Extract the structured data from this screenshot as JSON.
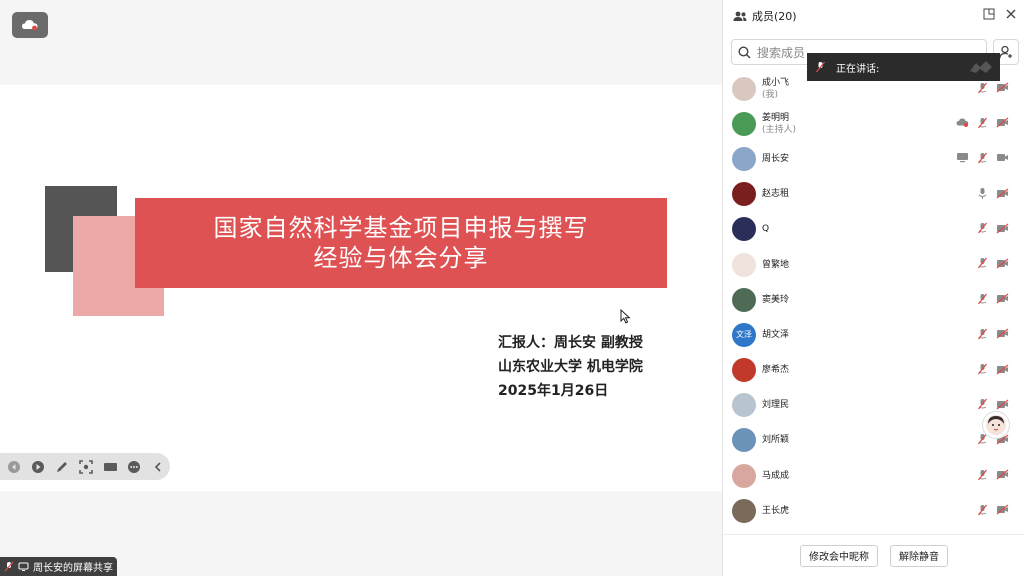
{
  "share": {
    "title_line1": "国家自然科学基金项目申报与撰写",
    "title_line2": "经验与体会分享",
    "reporter": "汇报人：周长安  副教授",
    "affiliation": "山东农业大学 机电学院",
    "date": "2025年1月26日",
    "sharing_label": "周长安的屏幕共享",
    "accent_color": "#de5254"
  },
  "panel": {
    "title": "成员(20)",
    "search_placeholder": "搜索成员",
    "speaking_label": "正在讲话:",
    "members": [
      {
        "name": "成小飞",
        "sub": "(我)",
        "avatar_color": "#d9c8c0",
        "icons": [
          "mic-off-icon",
          "camera-off-icon"
        ]
      },
      {
        "name": "姜明明",
        "sub": "(主持人)",
        "avatar_color": "#4a9a58",
        "icons": [
          "cloud-record-icon",
          "mic-off-icon",
          "camera-off-icon"
        ]
      },
      {
        "name": "周长安",
        "sub": "",
        "avatar_color": "#8aa6c8",
        "icons": [
          "screen-share-icon",
          "mic-off-icon",
          "camera-icon"
        ]
      },
      {
        "name": "赵志租",
        "sub": "",
        "avatar_color": "#7a1e1e",
        "icons": [
          "mic-icon",
          "camera-off-icon"
        ]
      },
      {
        "name": "Q",
        "sub": "",
        "avatar_color": "#2a2f5a",
        "icons": [
          "mic-off-icon",
          "camera-off-icon"
        ]
      },
      {
        "name": "曾繁地",
        "sub": "",
        "avatar_color": "#f0e2dc",
        "icons": [
          "mic-off-icon",
          "camera-off-icon"
        ]
      },
      {
        "name": "窦美玲",
        "sub": "",
        "avatar_color": "#4f6a55",
        "icons": [
          "mic-off-icon",
          "camera-off-icon"
        ]
      },
      {
        "name": "胡文泽",
        "sub": "",
        "avatar_color": "#2f77c9",
        "avatar_text": "文泽",
        "icons": [
          "mic-off-icon",
          "camera-off-icon"
        ]
      },
      {
        "name": "廖希杰",
        "sub": "",
        "avatar_color": "#c0392b",
        "icons": [
          "mic-off-icon",
          "camera-off-icon"
        ]
      },
      {
        "name": "刘理民",
        "sub": "",
        "avatar_color": "#b8c4d0",
        "icons": [
          "mic-off-icon",
          "camera-off-icon"
        ]
      },
      {
        "name": "刘所颖",
        "sub": "",
        "avatar_color": "#6b93b8",
        "icons": [
          "mic-off-icon",
          "camera-off-icon"
        ]
      },
      {
        "name": "马成成",
        "sub": "",
        "avatar_color": "#d8a8a0",
        "icons": [
          "mic-off-icon",
          "camera-off-icon"
        ]
      },
      {
        "name": "王长虎",
        "sub": "",
        "avatar_color": "#7a6a5a",
        "icons": [
          "mic-off-icon",
          "camera-off-icon"
        ]
      }
    ],
    "rename_button": "修改会中昵称",
    "unmute_button": "解除静音"
  }
}
